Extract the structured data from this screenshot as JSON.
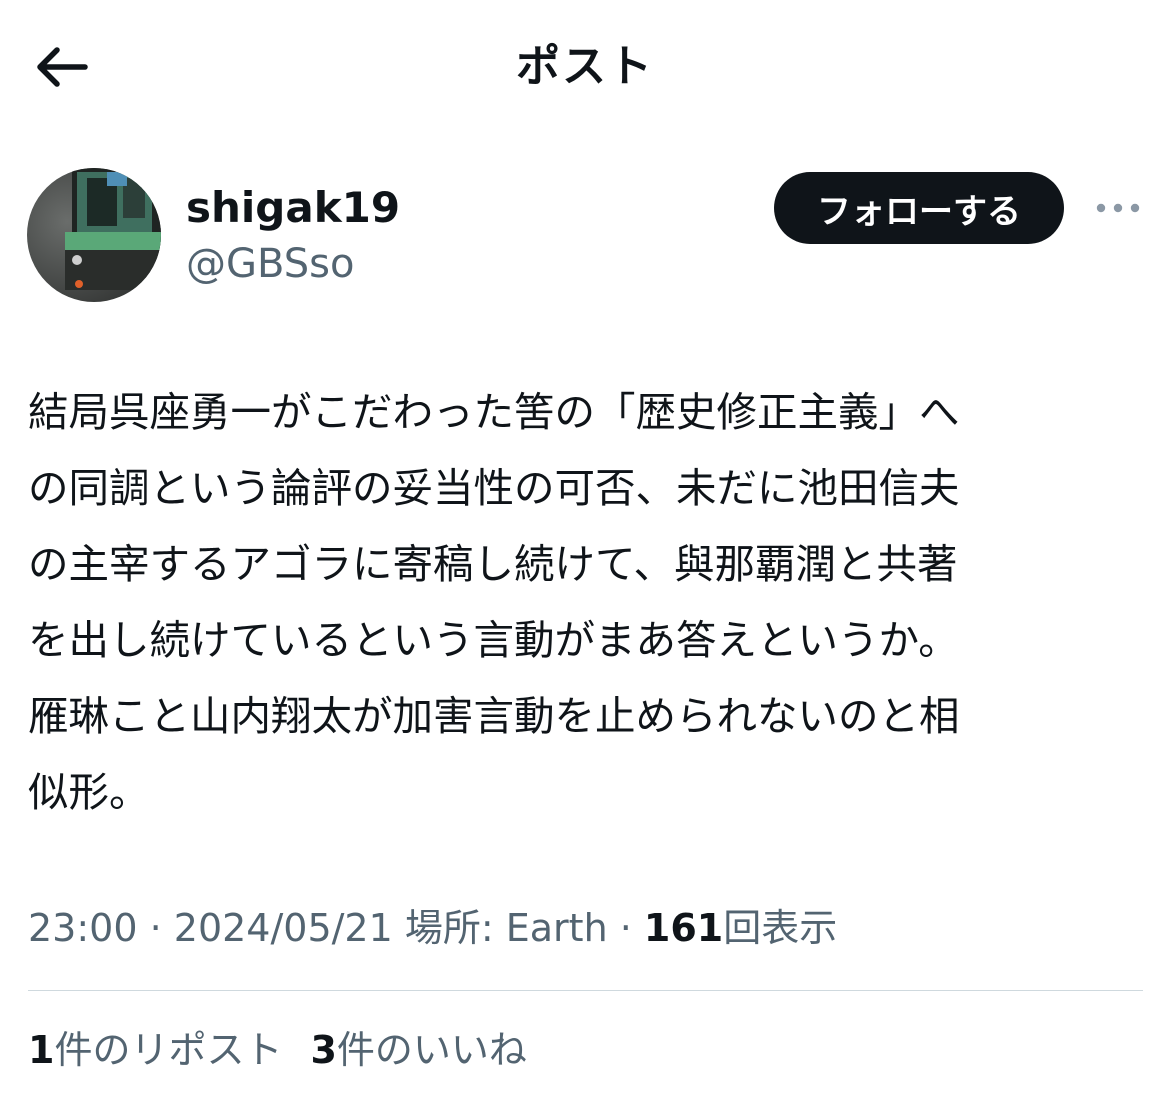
{
  "header": {
    "title": "ポスト",
    "back_icon": "arrow-left-icon"
  },
  "author": {
    "display_name": "shigak19",
    "handle": "@GBSso",
    "follow_label": "フォローする",
    "more_icon": "more-horizontal-icon"
  },
  "post": {
    "text": "結局呉座勇一がこだわった筈の「歴史修正主義」へ\nの同調という論評の妥当性の可否、未だに池田信夫\nの主宰するアゴラに寄稿し続けて、與那覇潤と共著\nを出し続けているという言動がまあ答えというか。\n雁琳こと山内翔太が加害言動を止められないのと相\n似形。"
  },
  "meta": {
    "time": "23:00",
    "sep1": " · ",
    "date": "2024/05/21",
    "location_label": " 場所: ",
    "location": "Earth",
    "sep2": " · ",
    "views_count": "161",
    "views_label": "回表示"
  },
  "stats": {
    "reposts_count": "1",
    "reposts_label": "件のリポスト",
    "likes_count": "3",
    "likes_label": "件のいいね"
  },
  "colors": {
    "text_primary": "#0f1419",
    "text_secondary": "#536471",
    "divider": "#cfd9de",
    "button_bg": "#0f1419"
  }
}
